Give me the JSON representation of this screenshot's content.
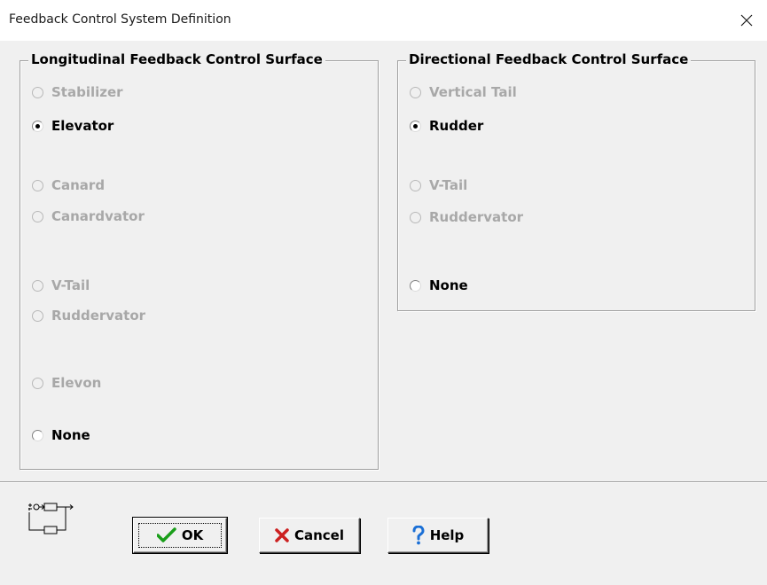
{
  "window": {
    "title": "Feedback Control System Definition"
  },
  "longitudinal": {
    "title": "Longitudinal Feedback Control Surface",
    "options": [
      {
        "label": "Stabilizer",
        "enabled": false,
        "selected": false
      },
      {
        "label": "Elevator",
        "enabled": true,
        "selected": true
      },
      {
        "label": "Canard",
        "enabled": false,
        "selected": false
      },
      {
        "label": "Canardvator",
        "enabled": false,
        "selected": false
      },
      {
        "label": "V-Tail",
        "enabled": false,
        "selected": false
      },
      {
        "label": "Ruddervator",
        "enabled": false,
        "selected": false
      },
      {
        "label": "Elevon",
        "enabled": false,
        "selected": false
      },
      {
        "label": "None",
        "enabled": true,
        "selected": false
      }
    ]
  },
  "directional": {
    "title": "Directional Feedback Control Surface",
    "options": [
      {
        "label": "Vertical Tail",
        "enabled": false,
        "selected": false
      },
      {
        "label": "Rudder",
        "enabled": true,
        "selected": true
      },
      {
        "label": "V-Tail",
        "enabled": false,
        "selected": false
      },
      {
        "label": "Ruddervator",
        "enabled": false,
        "selected": false
      },
      {
        "label": "None",
        "enabled": true,
        "selected": false
      }
    ]
  },
  "buttons": {
    "ok": {
      "label": "OK",
      "icon": "checkmark-icon",
      "color": "#1a9e1a"
    },
    "cancel": {
      "label": "Cancel",
      "icon": "x-mark-icon",
      "color": "#cc2020"
    },
    "help": {
      "label": "Help",
      "icon": "question-mark-icon",
      "color": "#1a6fd6"
    }
  },
  "feedback_loop_icon": "feedback-loop-diagram-icon"
}
